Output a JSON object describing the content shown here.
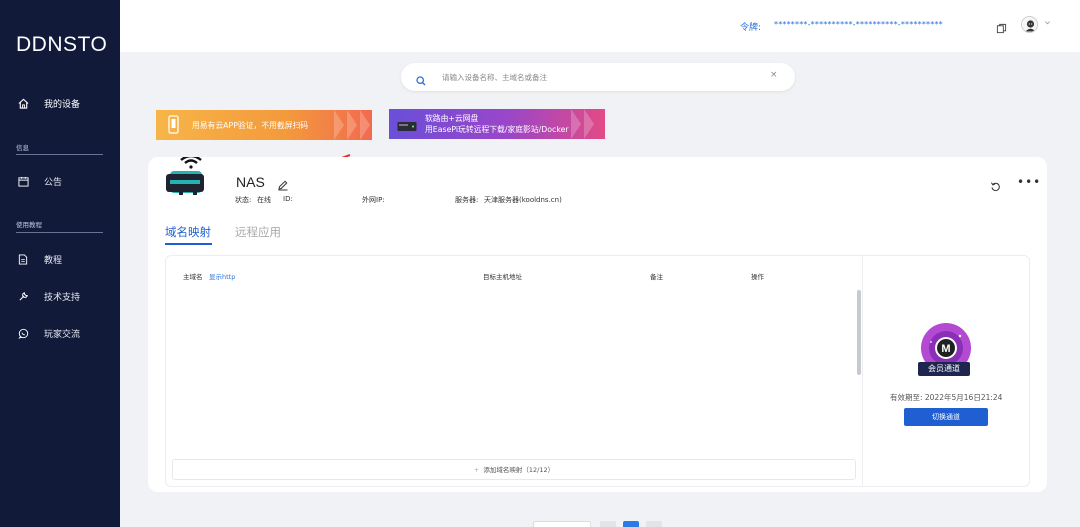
{
  "sidebar": {
    "logo": "DDNSTO",
    "items": [
      {
        "label": "我的设备"
      },
      {
        "label": "公告"
      },
      {
        "label": "教程"
      },
      {
        "label": "技术支持"
      },
      {
        "label": "玩家交流"
      }
    ],
    "sections": {
      "info": "信息",
      "tutorial": "使用教程"
    }
  },
  "header": {
    "token_label": "令牌:",
    "token_value": "********-**********-**********-**********"
  },
  "search": {
    "placeholder": "请输入设备名称、主域名或备注",
    "clear": "×"
  },
  "banners": {
    "b1": {
      "text": "用易有云APP验证，不用截屏扫码"
    },
    "b2": {
      "line1": "软路由+云网盘",
      "line2": "用EasePi玩转远程下载/家庭影站/Docker"
    }
  },
  "device": {
    "name": "NAS",
    "status_label": "状态:",
    "status_value": "在线",
    "id_label": "ID:",
    "ip_label": "外网IP:",
    "server_label": "服务器:",
    "server_value": "天津服务器(kooldns.cn)",
    "more": "•••"
  },
  "tabs": [
    {
      "label": "域名映射"
    },
    {
      "label": "远程应用"
    }
  ],
  "table": {
    "col_domain": "主域名",
    "col_domain_link": "显示http",
    "col_target": "目标主机地址",
    "col_note": "备注",
    "col_action": "操作",
    "add_label": "添加域名映射（12/12）",
    "add_plus": "+"
  },
  "membership": {
    "badge_letter": "M",
    "label": "会员通道",
    "expire": "有效期至: 2022年5月16日21:24",
    "button": "切换通道"
  },
  "colors": {
    "sidebar_bg": "#121a3a",
    "accent": "#1f5fd1"
  }
}
